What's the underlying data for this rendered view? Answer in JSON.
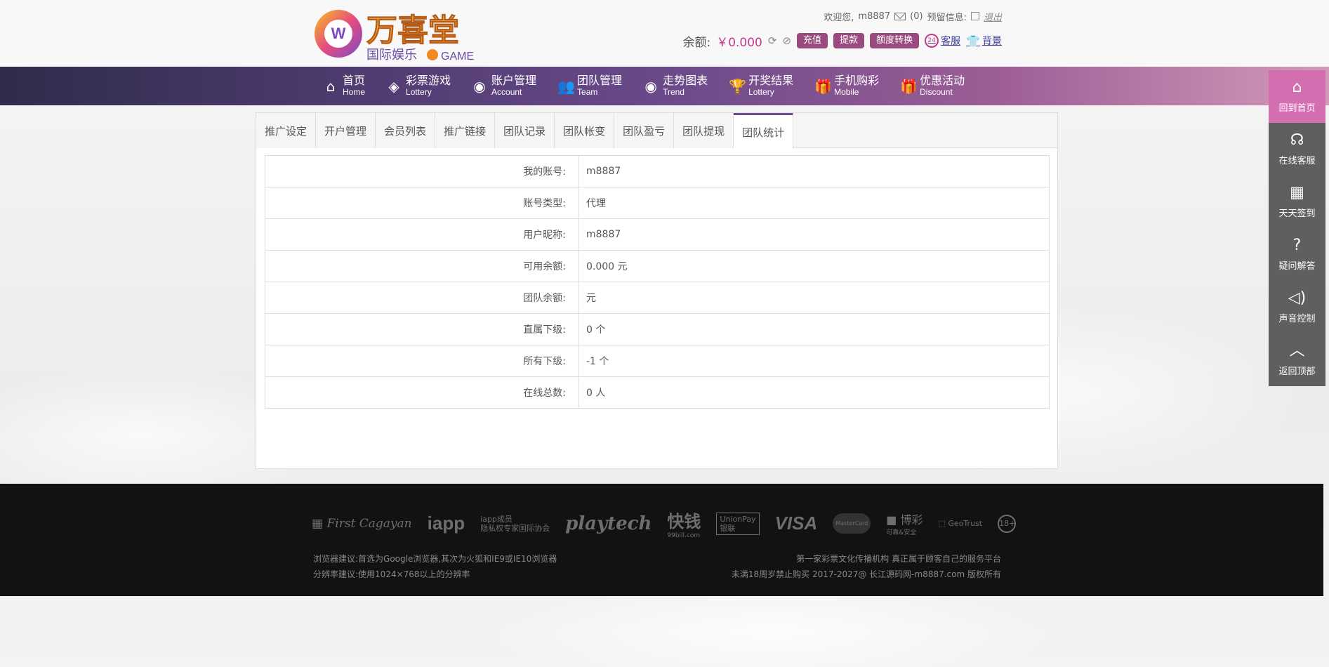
{
  "header": {
    "brand_name": "万喜堂",
    "brand_sub": "国际娱乐",
    "brand_game": "GAME",
    "welcome": "欢迎您,",
    "username": "m8887",
    "mail_count": "(0)",
    "reserve_label": "预留信息:",
    "logout": "退出",
    "balance_label": "余额:",
    "balance_value": "￥0.000",
    "recharge": "充值",
    "withdraw": "提款",
    "transfer": "额度转换",
    "service": "客服",
    "background": "背景"
  },
  "nav": [
    {
      "zh": "首页",
      "en": "Home",
      "icon": "home-icon"
    },
    {
      "zh": "彩票游戏",
      "en": "Lottery",
      "icon": "ticket-icon"
    },
    {
      "zh": "账户管理",
      "en": "Account",
      "icon": "account-icon"
    },
    {
      "zh": "团队管理",
      "en": "Team",
      "icon": "team-icon"
    },
    {
      "zh": "走势图表",
      "en": "Trend",
      "icon": "trend-icon"
    },
    {
      "zh": "开奖结果",
      "en": "Lottery",
      "icon": "trophy-icon"
    },
    {
      "zh": "手机购彩",
      "en": "Mobile",
      "icon": "gift-icon"
    },
    {
      "zh": "优惠活动",
      "en": "Discount",
      "icon": "gift-icon"
    }
  ],
  "tabs": [
    "推广设定",
    "开户管理",
    "会员列表",
    "推广链接",
    "团队记录",
    "团队帐变",
    "团队盈亏",
    "团队提现",
    "团队统计"
  ],
  "active_tab": "团队统计",
  "rows": [
    {
      "key": "我的账号:",
      "value": "m8887"
    },
    {
      "key": "账号类型:",
      "value": "代理"
    },
    {
      "key": "用户昵称:",
      "value": "m8887"
    },
    {
      "key": "可用余额:",
      "value": "0.000 元"
    },
    {
      "key": "团队余额:",
      "value": "元"
    },
    {
      "key": "直属下级:",
      "value": "0 个"
    },
    {
      "key": "所有下级:",
      "value": "-1 个"
    },
    {
      "key": "在线总数:",
      "value": "0 人"
    }
  ],
  "sidebar": [
    {
      "label": "回到首页",
      "icon": "home-icon"
    },
    {
      "label": "在线客服",
      "icon": "headset-icon"
    },
    {
      "label": "天天签到",
      "icon": "calendar-icon"
    },
    {
      "label": "疑问解答",
      "icon": "question-icon"
    },
    {
      "label": "声音控制",
      "icon": "speaker-icon"
    },
    {
      "label": "返回顶部",
      "icon": "arrow-up-icon"
    }
  ],
  "footer": {
    "partners": {
      "first_cagayan": "First Cagayan",
      "iapp": "iapp",
      "iapp_desc_1": "iapp成员",
      "iapp_desc_2": "隐私权专家国际协会",
      "playtech": "playtech",
      "kuaiqian": "快钱",
      "kuaiqian_sub": "99bill.com",
      "yinlian": "UnionPay",
      "yinlian_sub": "银联",
      "visa": "VISA",
      "mastercard": "MasterCard",
      "bocai_tag": "可靠&安全",
      "bocai": "博彩",
      "geo": "GeoTrust",
      "age": "18+"
    },
    "left_line1": "浏览器建议:首选为Google浏览器,其次为火狐和IE9或IE10浏览器",
    "left_line2": "分辨率建议:使用1024×768以上的分辨率",
    "right_line1": "第一家彩票文化传播机构 真正属于顾客自己的服务平台",
    "right_line2": "未满18周岁禁止购买 2017-2027@ 长江源码网-m8887.com 版权所有"
  },
  "colors": {
    "accent": "#9a4a7e",
    "sidebar_active": "#d36fb0",
    "sidebar": "#5f5f5f",
    "footer": "#121212"
  }
}
